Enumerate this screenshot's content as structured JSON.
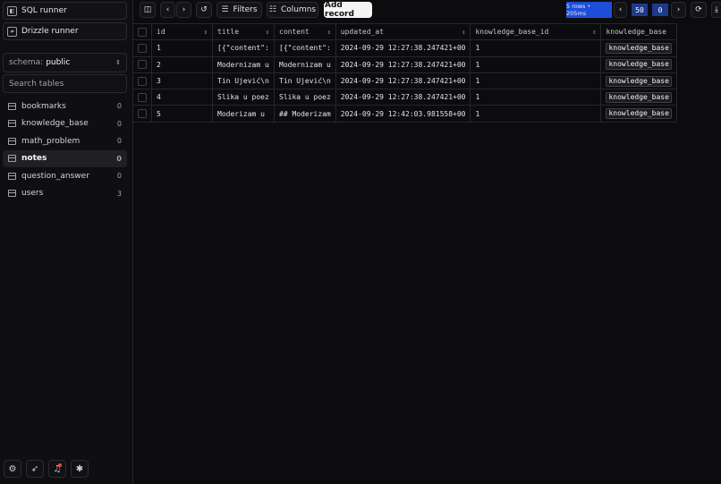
{
  "sidebar": {
    "sql_runner": "SQL runner",
    "drizzle_runner": "Drizzle runner",
    "schema_label": "schema:",
    "schema_value": "public",
    "search_placeholder": "Search tables",
    "tables": [
      {
        "name": "bookmarks",
        "count": "0"
      },
      {
        "name": "knowledge_base",
        "count": "0"
      },
      {
        "name": "math_problem",
        "count": "0"
      },
      {
        "name": "notes",
        "count": "0"
      },
      {
        "name": "question_answer",
        "count": "0"
      },
      {
        "name": "users",
        "count": "3"
      }
    ],
    "active_table": "notes",
    "bottom_icons": [
      "settings-icon",
      "rocket-icon",
      "bell-icon",
      "bug-icon"
    ]
  },
  "toolbar": {
    "filters": "Filters",
    "columns": "Columns",
    "add_record": "Add record",
    "rows_info": "5 rows • 205ms",
    "limit": "50",
    "offset": "0"
  },
  "grid": {
    "columns": [
      "id",
      "title",
      "content",
      "updated_at",
      "knowledge_base_id",
      "knowledge_base"
    ],
    "rows": [
      {
        "id": "1",
        "title": "[{\"content\":",
        "content": "[{\"content\":",
        "updated_at": "2024-09-29 12:27:38.247421+00",
        "knowledge_base_id": "1",
        "knowledge_base": "knowledge_base"
      },
      {
        "id": "2",
        "title": "Modernizam u",
        "content": "Modernizam u",
        "updated_at": "2024-09-29 12:27:38.247421+00",
        "knowledge_base_id": "1",
        "knowledge_base": "knowledge_base"
      },
      {
        "id": "3",
        "title": "Tin Ujević\\n",
        "content": "Tin Ujević\\n",
        "updated_at": "2024-09-29 12:27:38.247421+00",
        "knowledge_base_id": "1",
        "knowledge_base": "knowledge_base"
      },
      {
        "id": "4",
        "title": "Slika u poez",
        "content": "Slika u poez",
        "updated_at": "2024-09-29 12:27:38.247421+00",
        "knowledge_base_id": "1",
        "knowledge_base": "knowledge_base"
      },
      {
        "id": "5",
        "title": "Moderizam u",
        "content": "## Moderizam",
        "updated_at": "2024-09-29 12:42:03.981558+00",
        "knowledge_base_id": "1",
        "knowledge_base": "knowledge_base"
      }
    ]
  }
}
